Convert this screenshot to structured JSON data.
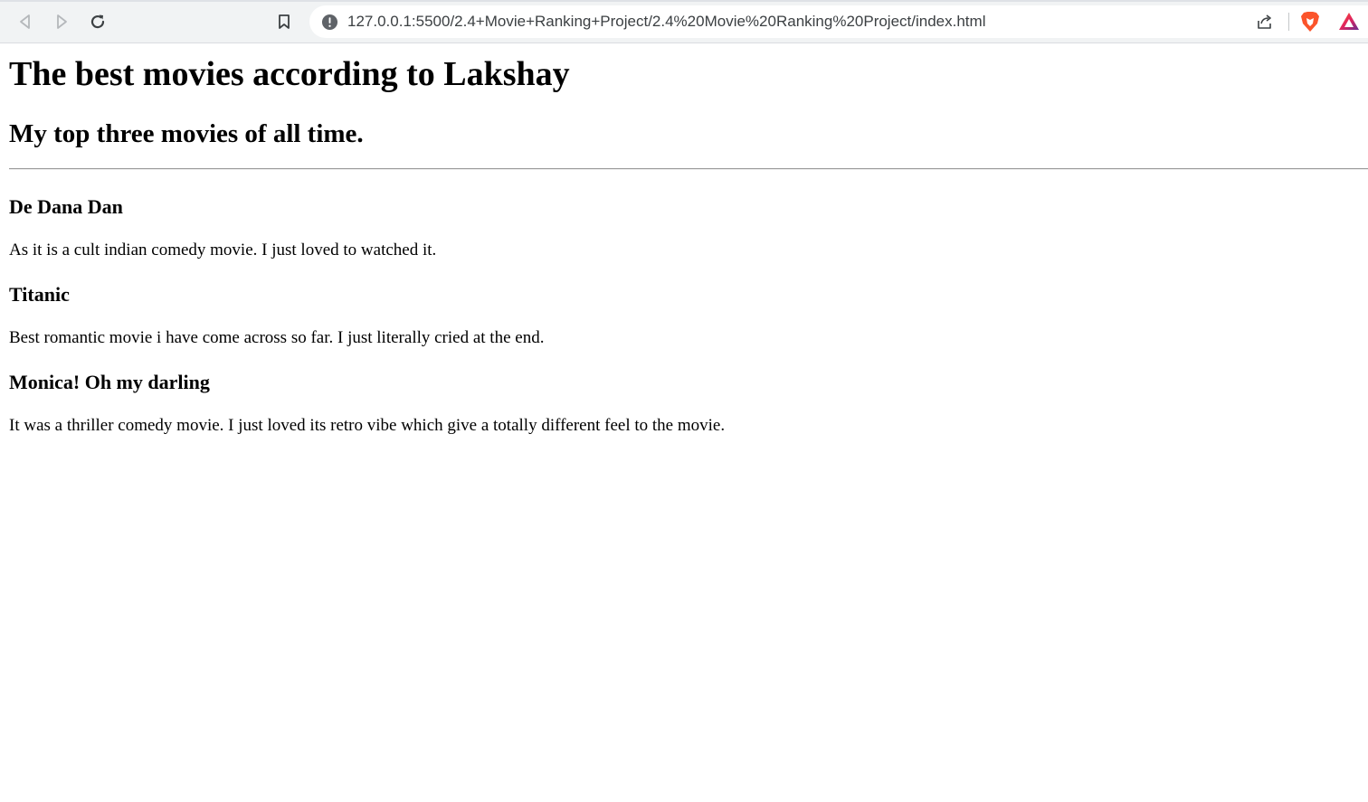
{
  "browser": {
    "url": "127.0.0.1:5500/2.4+Movie+Ranking+Project/2.4%20Movie%20Ranking%20Project/index.html",
    "icons": [
      "back-icon",
      "forward-icon",
      "reload-icon",
      "bookmark-icon",
      "info-icon",
      "share-icon",
      "brave-lion-icon",
      "brave-rewards-icon"
    ],
    "colors": {
      "brave_orange": "#fb542b",
      "rewards_purple": "#662d91"
    }
  },
  "page": {
    "title": "The best movies according to Lakshay",
    "subtitle": "My top three movies of all time.",
    "movies": [
      {
        "title": "De Dana Dan",
        "description": "As it is a cult indian comedy movie. I just loved to watched it."
      },
      {
        "title": "Titanic",
        "description": "Best romantic movie i have come across so far. I just literally cried at the end."
      },
      {
        "title": "Monica! Oh my darling",
        "description": "It was a thriller comedy movie. I just loved its retro vibe which give a totally different feel to the movie."
      }
    ]
  }
}
